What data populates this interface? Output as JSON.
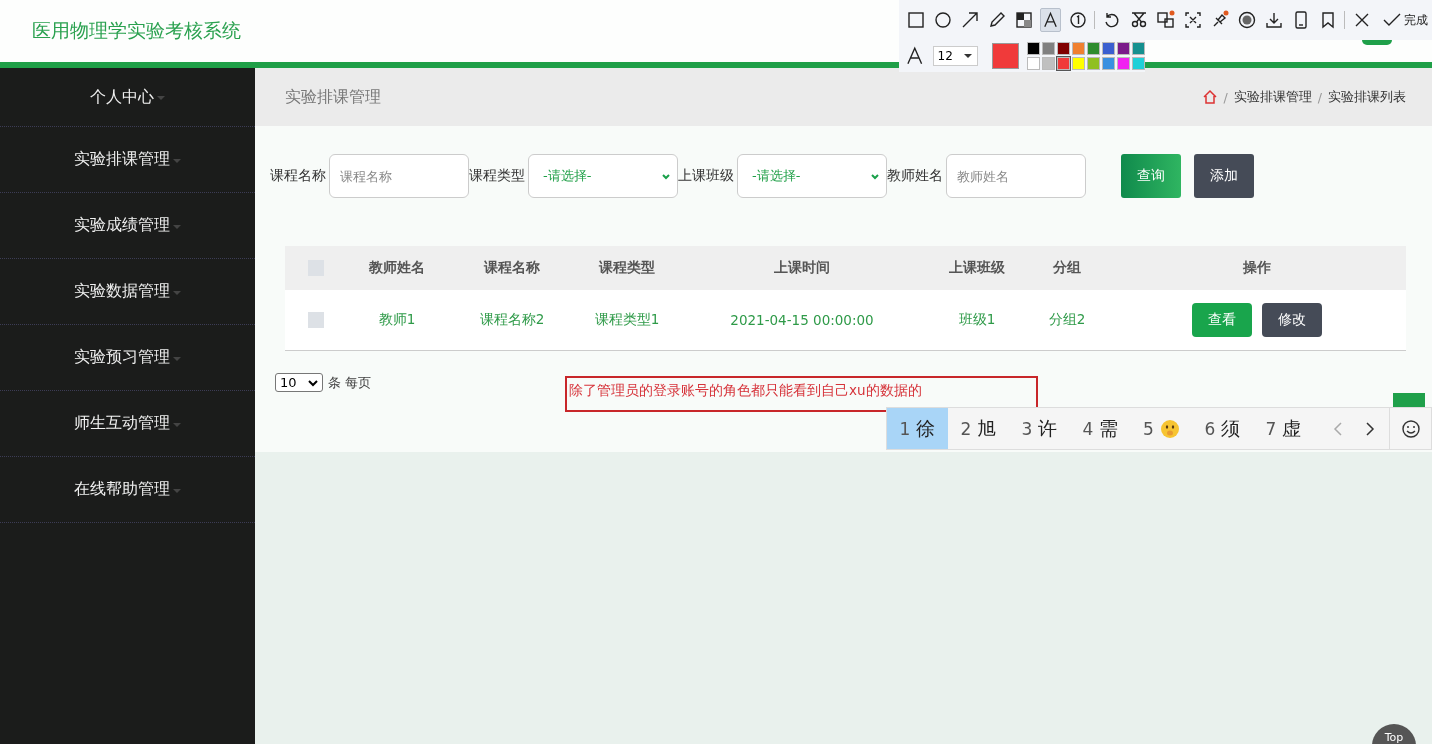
{
  "header": {
    "title": "医用物理学实验考核系统"
  },
  "sidebar": {
    "items": [
      {
        "label": "个人中心",
        "has_caret": true,
        "selected": false
      },
      {
        "label": "实验排课管理",
        "has_caret": true,
        "selected": false
      },
      {
        "label": "实验成绩管理",
        "has_caret": true,
        "selected": false
      },
      {
        "label": "实验数据管理",
        "has_caret": true,
        "selected": false
      },
      {
        "label": "实验预习管理",
        "has_caret": true,
        "selected": false
      },
      {
        "label": "师生互动管理",
        "has_caret": true,
        "selected": false
      },
      {
        "label": "在线帮助管理",
        "has_caret": true,
        "selected": false
      }
    ]
  },
  "page_title": "实验排课管理",
  "breadcrumb": [
    {
      "separator": "/",
      "label": "实验排课管理"
    },
    {
      "separator": "/",
      "label": "实验排课列表"
    }
  ],
  "filters": [
    {
      "kind": "text",
      "label": "课程名称",
      "placeholder": "课程名称"
    },
    {
      "kind": "select",
      "label": "课程类型",
      "value": "-请选择-"
    },
    {
      "kind": "select",
      "label": "上课班级",
      "value": "-请选择-"
    },
    {
      "kind": "text",
      "label": "教师姓名",
      "placeholder": "教师姓名"
    }
  ],
  "buttons": [
    {
      "kind": "primary",
      "label": "查询"
    },
    {
      "kind": "dark",
      "label": "添加"
    }
  ],
  "table": {
    "all_selected": false,
    "columns": [
      "教师姓名",
      "课程名称",
      "课程类型",
      "上课时间",
      "上课班级",
      "分组",
      "操作"
    ],
    "rows": [
      {
        "selected": false,
        "cells": [
          "教师1",
          "课程名称2",
          "课程类型1",
          "2021-04-15 00:00:00",
          "班级1",
          "分组2"
        ],
        "actions": [
          {
            "kind": "primary",
            "label": "查看"
          },
          {
            "kind": "dark",
            "label": "修改"
          }
        ]
      }
    ]
  },
  "pagination": {
    "page_size": "10",
    "label": "条 每页"
  },
  "annotation": {
    "text": "除了管理员的登录账号的角色都只能看到自己xu的数据的"
  },
  "back_to_top": {
    "label": "Top"
  },
  "screenshot_toolbar": {
    "tools": [
      {
        "kind": "rect",
        "selected": false
      },
      {
        "kind": "circle",
        "selected": false
      },
      {
        "kind": "arrow",
        "selected": false
      },
      {
        "kind": "pencil",
        "selected": false
      },
      {
        "kind": "mosaic",
        "selected": false
      },
      {
        "kind": "text",
        "selected": true
      },
      {
        "kind": "number",
        "selected": false
      },
      {
        "kind": "undo",
        "selected": false
      },
      {
        "kind": "cut",
        "selected": false
      },
      {
        "kind": "translate",
        "selected": false
      },
      {
        "kind": "ocr",
        "selected": false
      },
      {
        "kind": "pin",
        "selected": false
      },
      {
        "kind": "record",
        "selected": false
      },
      {
        "kind": "download",
        "selected": false
      },
      {
        "kind": "phone",
        "selected": false
      },
      {
        "kind": "bookmark",
        "selected": false
      },
      {
        "kind": "close",
        "selected": false
      }
    ],
    "done_label": "完成",
    "font_size": "12",
    "palette": [
      {
        "color": "#000000",
        "selected": false
      },
      {
        "color": "#808080",
        "selected": false
      },
      {
        "color": "#800000",
        "selected": false
      },
      {
        "color": "#f08030",
        "selected": false
      },
      {
        "color": "#2e8b2e",
        "selected": false
      },
      {
        "color": "#3a5fd0",
        "selected": false
      },
      {
        "color": "#7a1a8a",
        "selected": false
      },
      {
        "color": "#15908f",
        "selected": false
      },
      {
        "color": "#ffffff",
        "selected": false
      },
      {
        "color": "#c0c0c0",
        "selected": false
      },
      {
        "color": "#f03a3a",
        "selected": true
      },
      {
        "color": "#ffff00",
        "selected": false
      },
      {
        "color": "#90c020",
        "selected": false
      },
      {
        "color": "#3a90e0",
        "selected": false
      },
      {
        "color": "#f020f0",
        "selected": false
      },
      {
        "color": "#20d0d8",
        "selected": false
      }
    ]
  },
  "ime": {
    "candidates": [
      {
        "kind": "text",
        "index": "1",
        "text": "徐",
        "selected": true
      },
      {
        "kind": "text",
        "index": "2",
        "text": "旭",
        "selected": false
      },
      {
        "kind": "text",
        "index": "3",
        "text": "许",
        "selected": false
      },
      {
        "kind": "text",
        "index": "4",
        "text": "需",
        "selected": false
      },
      {
        "kind": "emoji",
        "index": "5",
        "selected": false
      },
      {
        "kind": "text",
        "index": "6",
        "text": "须",
        "selected": false
      },
      {
        "kind": "text",
        "index": "7",
        "text": "虚",
        "selected": false
      }
    ]
  }
}
